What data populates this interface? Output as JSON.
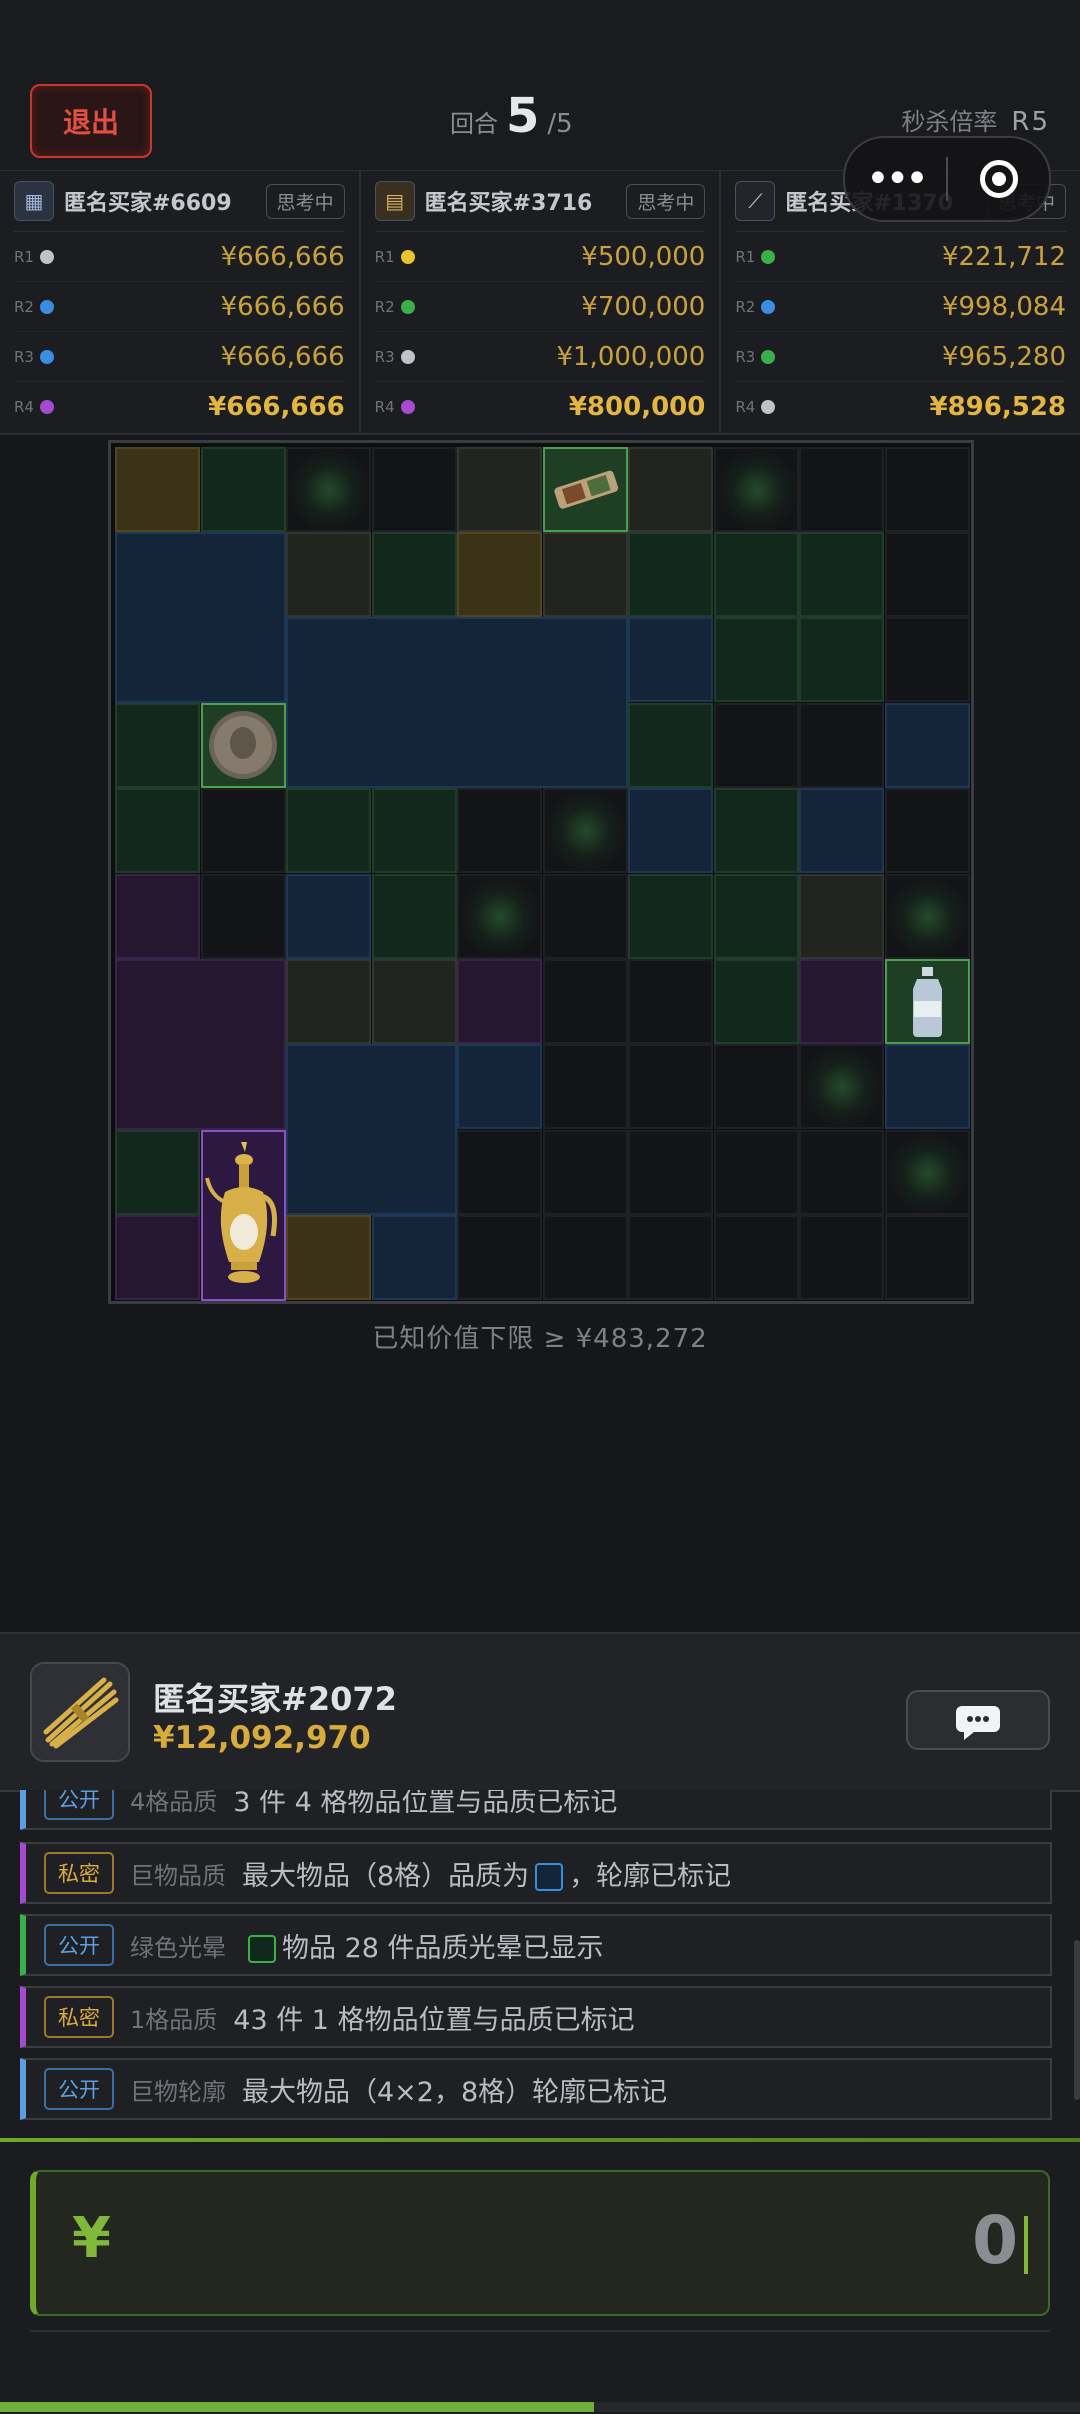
{
  "header": {
    "exit_label": "退出",
    "round_label": "回合",
    "round_current": "5",
    "round_total": "/5",
    "rate_label": "秒杀倍率",
    "rate_value": "R5"
  },
  "buyers": [
    {
      "name": "匿名买家#6609",
      "status": "思考中",
      "bids": [
        {
          "round": "R1",
          "dot": "#bfc2c6",
          "value": "¥666,666"
        },
        {
          "round": "R2",
          "dot": "#3b8de0",
          "value": "¥666,666"
        },
        {
          "round": "R3",
          "dot": "#3b8de0",
          "value": "¥666,666"
        },
        {
          "round": "R4",
          "dot": "#a64bd0",
          "value": "¥666,666"
        }
      ]
    },
    {
      "name": "匿名买家#3716",
      "status": "思考中",
      "bids": [
        {
          "round": "R1",
          "dot": "#e6c531",
          "value": "¥500,000"
        },
        {
          "round": "R2",
          "dot": "#3bb04a",
          "value": "¥700,000"
        },
        {
          "round": "R3",
          "dot": "#bfc2c6",
          "value": "¥1,000,000"
        },
        {
          "round": "R4",
          "dot": "#a64bd0",
          "value": "¥800,000"
        }
      ]
    },
    {
      "name": "匿名买家#1370",
      "status": "思考中",
      "bids": [
        {
          "round": "R1",
          "dot": "#3bb04a",
          "value": "¥221,712"
        },
        {
          "round": "R2",
          "dot": "#3b8de0",
          "value": "¥998,084"
        },
        {
          "round": "R3",
          "dot": "#3bb04a",
          "value": "¥965,280"
        },
        {
          "round": "R4",
          "dot": "#bfc2c6",
          "value": "¥896,528"
        }
      ]
    }
  ],
  "board": {
    "value_floor": "已知价值下限 ≥ ¥483,272"
  },
  "winner": {
    "name": "匿名买家#2072",
    "amount": "¥12,092,970"
  },
  "logs": [
    {
      "tag": "公开",
      "type": "pub",
      "category": "4格品质",
      "text": "3 件 4 格物品位置与品质已标记",
      "bar": "#5b9fe0"
    },
    {
      "tag": "私密",
      "type": "priv",
      "category": "巨物品质",
      "text_before": "最大物品（8格）品质为",
      "text_after": "，轮廓已标记",
      "square": "#3b8de0",
      "bar": "#a64bd0"
    },
    {
      "tag": "公开",
      "type": "pub",
      "category": "绿色光晕",
      "text_before": "",
      "text_after": "物品 28 件品质光晕已显示",
      "square": "#3bb04a",
      "bar": "#3bb04a"
    },
    {
      "tag": "私密",
      "type": "priv",
      "category": "1格品质",
      "text": "43 件 1 格物品位置与品质已标记",
      "bar": "#a64bd0"
    },
    {
      "tag": "公开",
      "type": "pub",
      "category": "巨物轮廓",
      "text": "最大物品（4×2，8格）轮廓已标记",
      "bar": "#5b9fe0"
    }
  ],
  "bid_input": {
    "currency": "¥",
    "value": "0",
    "progress": 0.55
  }
}
